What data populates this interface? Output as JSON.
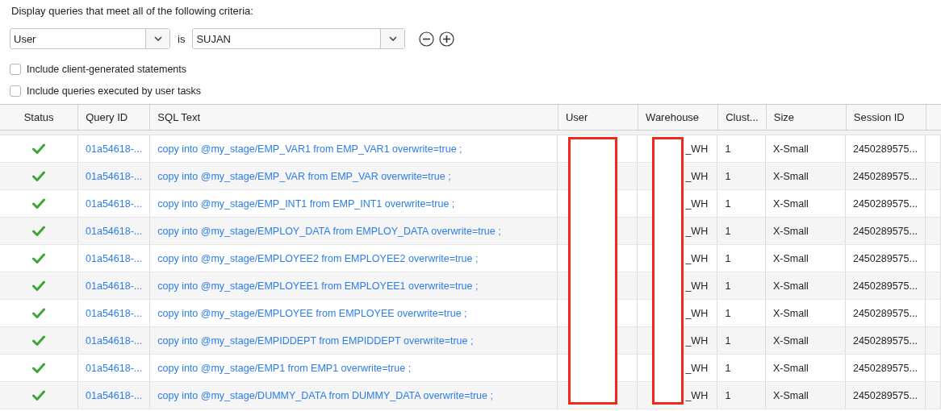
{
  "criteria_heading": "Display queries that meet all of the following criteria:",
  "filter": {
    "field": "User",
    "operator": "is",
    "value": "SUJAN"
  },
  "options": [
    {
      "label": "Include client-generated statements",
      "checked": false
    },
    {
      "label": "Include queries executed by user tasks",
      "checked": false
    }
  ],
  "table": {
    "columns": [
      "Status",
      "Query ID",
      "SQL Text",
      "User",
      "Warehouse",
      "Clust...",
      "Size",
      "Session ID"
    ],
    "rows": [
      {
        "succeeded": true,
        "query_id": "01a54618-...",
        "sql_text": "copy into @my_stage/EMP_VAR1 from EMP_VAR1 overwrite=true ;",
        "warehouse": "_WH",
        "clusters": "1",
        "size": "X-Small",
        "session_id": "2450289575..."
      },
      {
        "succeeded": true,
        "query_id": "01a54618-...",
        "sql_text": "copy into @my_stage/EMP_VAR from EMP_VAR overwrite=true ;",
        "warehouse": "_WH",
        "clusters": "1",
        "size": "X-Small",
        "session_id": "2450289575..."
      },
      {
        "succeeded": true,
        "query_id": "01a54618-...",
        "sql_text": "copy into @my_stage/EMP_INT1 from EMP_INT1 overwrite=true ;",
        "warehouse": "_WH",
        "clusters": "1",
        "size": "X-Small",
        "session_id": "2450289575..."
      },
      {
        "succeeded": true,
        "query_id": "01a54618-...",
        "sql_text": "copy into @my_stage/EMPLOY_DATA from EMPLOY_DATA overwrite=true ;",
        "warehouse": "_WH",
        "clusters": "1",
        "size": "X-Small",
        "session_id": "2450289575..."
      },
      {
        "succeeded": true,
        "query_id": "01a54618-...",
        "sql_text": "copy into @my_stage/EMPLOYEE2 from EMPLOYEE2 overwrite=true ;",
        "warehouse": "_WH",
        "clusters": "1",
        "size": "X-Small",
        "session_id": "2450289575..."
      },
      {
        "succeeded": true,
        "query_id": "01a54618-...",
        "sql_text": "copy into @my_stage/EMPLOYEE1 from EMPLOYEE1 overwrite=true ;",
        "warehouse": "_WH",
        "clusters": "1",
        "size": "X-Small",
        "session_id": "2450289575..."
      },
      {
        "succeeded": true,
        "query_id": "01a54618-...",
        "sql_text": "copy into @my_stage/EMPLOYEE from EMPLOYEE overwrite=true ;",
        "warehouse": "_WH",
        "clusters": "1",
        "size": "X-Small",
        "session_id": "2450289575..."
      },
      {
        "succeeded": true,
        "query_id": "01a54618-...",
        "sql_text": "copy into @my_stage/EMPIDDEPT from EMPIDDEPT overwrite=true ;",
        "warehouse": "_WH",
        "clusters": "1",
        "size": "X-Small",
        "session_id": "2450289575..."
      },
      {
        "succeeded": true,
        "query_id": "01a54618-...",
        "sql_text": "copy into @my_stage/EMP1 from EMP1 overwrite=true ;",
        "warehouse": "_WH",
        "clusters": "1",
        "size": "X-Small",
        "session_id": "2450289575..."
      },
      {
        "succeeded": true,
        "query_id": "01a54618-...",
        "sql_text": "copy into @my_stage/DUMMY_DATA from DUMMY_DATA overwrite=true ;",
        "warehouse": "_WH",
        "clusters": "1",
        "size": "X-Small",
        "session_id": "2450289575..."
      }
    ]
  }
}
